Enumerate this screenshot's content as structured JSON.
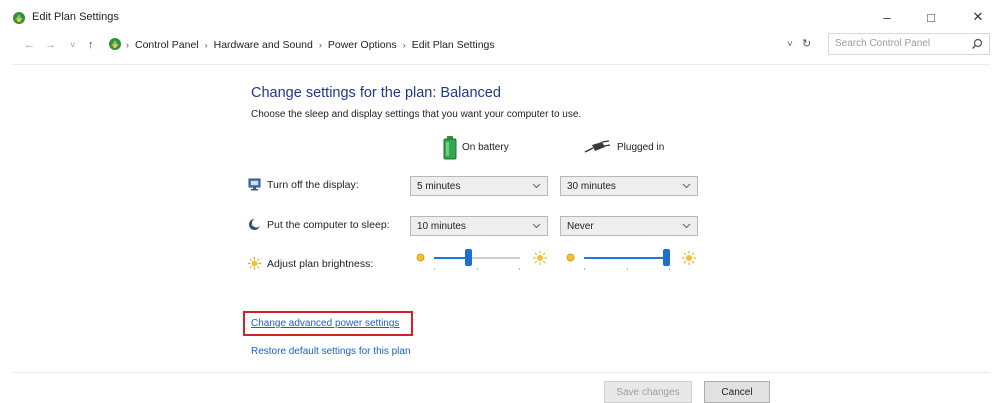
{
  "window": {
    "title": "Edit Plan Settings",
    "controls": {
      "minimize": "–",
      "maximize": "□",
      "close": "✕"
    }
  },
  "address_bar": {
    "back": "←",
    "forward": "→",
    "recent": "˅",
    "up": "↑",
    "breadcrumb": [
      "Control Panel",
      "Hardware and Sound",
      "Power Options",
      "Edit Plan Settings"
    ],
    "separator": "›",
    "dropdown_glyph": "˅",
    "refresh_glyph": "↻",
    "search_placeholder": "Search Control Panel"
  },
  "main": {
    "title": "Change settings for the plan: Balanced",
    "subtitle": "Choose the sleep and display settings that you want your computer to use.",
    "columns": {
      "battery": "On battery",
      "plugged": "Plugged in"
    },
    "rows": [
      {
        "label": "Turn off the display:",
        "battery_value": "5 minutes",
        "plugged_value": "30 minutes"
      },
      {
        "label": "Put the computer to sleep:",
        "battery_value": "10 minutes",
        "plugged_value": "Never"
      },
      {
        "label": "Adjust plan brightness:"
      }
    ],
    "brightness": {
      "battery_level": 0.4,
      "plugged_level": 0.95
    },
    "links": {
      "advanced": "Change advanced power settings",
      "restore": "Restore default settings for this plan"
    },
    "buttons": {
      "save": "Save changes",
      "cancel": "Cancel"
    }
  },
  "colors": {
    "accent": "#1f6fd1",
    "title": "#1e3a8a",
    "link": "#1a5fd0",
    "highlight": "#d42127"
  }
}
